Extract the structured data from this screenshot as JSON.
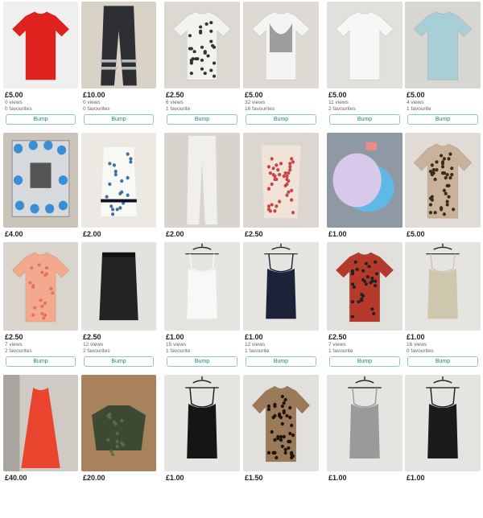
{
  "colors": {
    "accent": "#1a8a76",
    "bump_border": "#8fc9bd"
  },
  "items": [
    {
      "id": "red-tshirt",
      "price": "£5.00",
      "views": "0 views",
      "favs": "0 favourites",
      "bump": "Bump"
    },
    {
      "id": "black-trousers",
      "price": "£10.00",
      "views": "0 views",
      "favs": "0 favourites",
      "bump": "Bump"
    },
    {
      "id": "white-dotted-cardigan",
      "price": "£2.50",
      "views": "6 views",
      "favs": "1 favourite",
      "bump": "Bump"
    },
    {
      "id": "white-printed-top",
      "price": "£5.00",
      "views": "32 views",
      "favs": "16 favourites",
      "bump": "Bump"
    },
    {
      "id": "white-tshirt",
      "price": "£5.00",
      "views": "11 views",
      "favs": "2 favourites",
      "bump": "Bump"
    },
    {
      "id": "blue-top",
      "price": "£5.00",
      "views": "4 views",
      "favs": "1 favourite",
      "bump": "Bump"
    },
    {
      "id": "baby-photo-frame",
      "price": "£4.00"
    },
    {
      "id": "blue-floral-top",
      "price": "£2.00"
    },
    {
      "id": "white-jeans",
      "price": "£2.00"
    },
    {
      "id": "floral-frill-top",
      "price": "£2.50"
    },
    {
      "id": "baby-hats",
      "price": "£1.00"
    },
    {
      "id": "leopard-blouse",
      "price": "£5.00"
    },
    {
      "id": "peach-top",
      "price": "£2.50",
      "views": "7 views",
      "favs": "2 favourites",
      "bump": "Bump"
    },
    {
      "id": "black-skirt",
      "price": "£2.50",
      "views": "12 views",
      "favs": "2 favourites",
      "bump": "Bump"
    },
    {
      "id": "white-cami",
      "price": "£1.00",
      "views": "15 views",
      "favs": "1 favourite",
      "bump": "Bump"
    },
    {
      "id": "navy-cami",
      "price": "£1.00",
      "views": "12 views",
      "favs": "1 favourite",
      "bump": "Bump"
    },
    {
      "id": "red-pattern-top",
      "price": "£2.50",
      "views": "7 views",
      "favs": "1 favourite",
      "bump": "Bump"
    },
    {
      "id": "beige-cami",
      "price": "£1.00",
      "views": "16 views",
      "favs": "0 favourites",
      "bump": "Bump"
    },
    {
      "id": "red-maxi-dress",
      "price": "£40.00"
    },
    {
      "id": "kids-camo-jacket",
      "price": "£20.00"
    },
    {
      "id": "black-cami",
      "price": "£1.00"
    },
    {
      "id": "leopard-tshirt",
      "price": "£1.50"
    },
    {
      "id": "grey-vest",
      "price": "£1.00"
    },
    {
      "id": "black-vest",
      "price": "£1.00"
    }
  ]
}
